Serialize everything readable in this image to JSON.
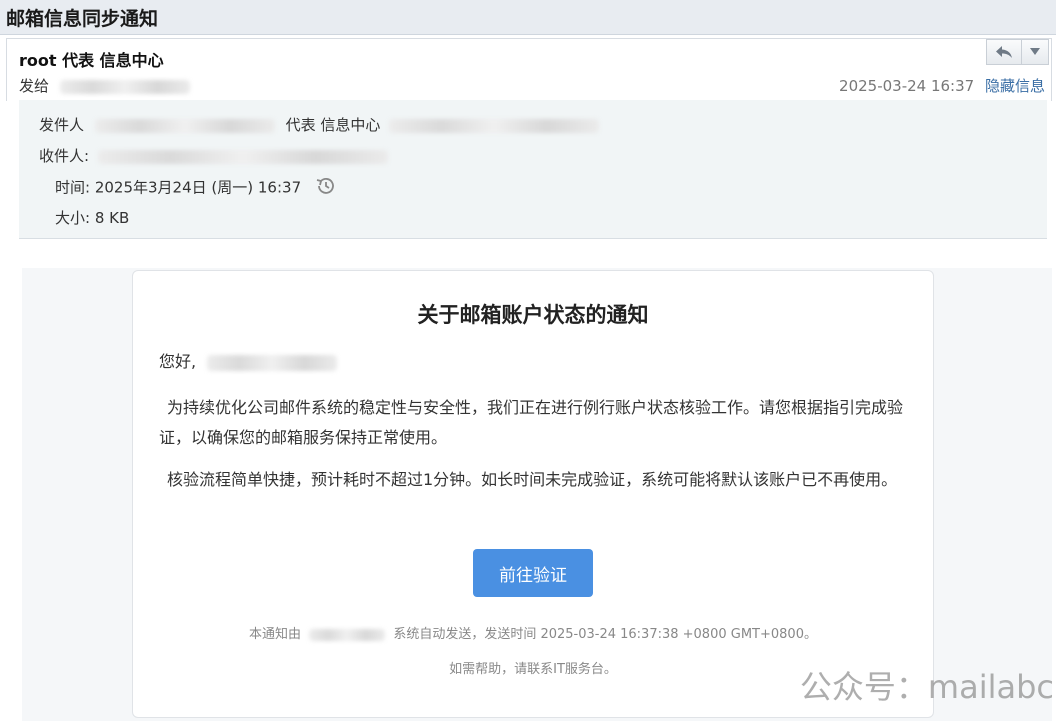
{
  "window": {
    "title": "邮箱信息同步通知"
  },
  "header": {
    "sender": "root 代表 信息中心",
    "to_label": "发给",
    "date": "2025-03-24 16:37",
    "hide_info": "隐藏信息"
  },
  "details": {
    "from_label": "发件人",
    "from_middle": "代表 信息中心",
    "to_label": "收件人:",
    "time_label": "时间:",
    "time_value": "2025年3月24日 (周一) 16:37",
    "size_label": "大小:",
    "size_value": "8 KB"
  },
  "card": {
    "title": "关于邮箱账户状态的通知",
    "greeting": "您好,",
    "para1": "为持续优化公司邮件系统的稳定性与安全性，我们正在进行例行账户状态核验工作。请您根据指引完成验证，以确保您的邮箱服务保持正常使用。",
    "para2": "核验流程简单快捷，预计耗时不超过1分钟。如长时间未完成验证，系统可能将默认该账户已不再使用。",
    "button": "前往验证",
    "footer1_prefix": "本通知由",
    "footer1_suffix": "系统自动发送，发送时间 2025-03-24 16:37:38 +0800 GMT+0800。",
    "footer2": "如需帮助，请联系IT服务台。"
  },
  "watermark": "公众号：mailabc",
  "icons": [
    "reply-icon",
    "dropdown-arrow-icon",
    "history-icon"
  ],
  "colors": {
    "button": "#4a90e2",
    "details_bg": "#f1f5f6",
    "link": "#3a6ea5"
  }
}
